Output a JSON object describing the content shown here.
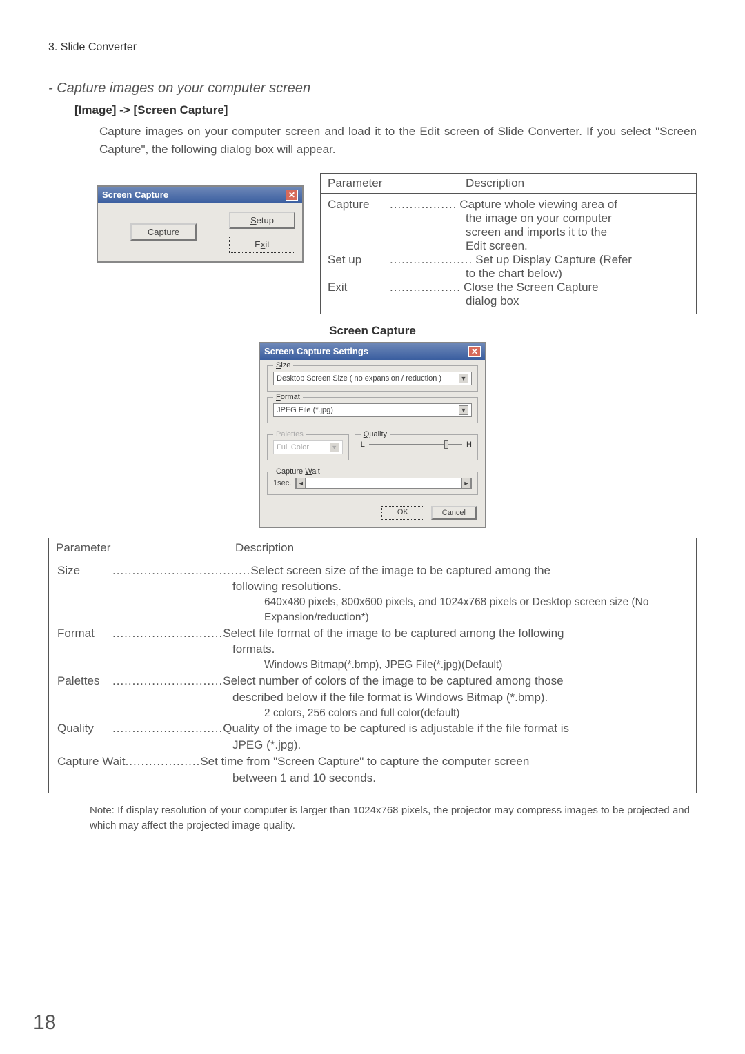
{
  "header": {
    "chapter": "3. Slide Converter"
  },
  "section_title": "- Capture images on your computer screen",
  "breadcrumb": "[Image] -> [Screen Capture]",
  "intro": "Capture images on your computer screen and load it to the Edit screen of Slide Converter.  If you select \"Screen Capture\", the following dialog box will appear.",
  "dialog1": {
    "title": "Screen Capture",
    "capture_btn": "Capture",
    "setup_btn": "Setup",
    "exit_btn": "Exit",
    "capture_u": "C",
    "setup_u": "S",
    "exit_u": "x"
  },
  "table1": {
    "h1": "Parameter",
    "h2": "Description",
    "rows": [
      {
        "name": "Capture",
        "dots": ".................",
        "desc": "Capture whole viewing area of"
      },
      {
        "cont": "the image on your computer"
      },
      {
        "cont": "screen and imports it to the"
      },
      {
        "cont": "Edit screen."
      },
      {
        "name": "Set up",
        "dots": ".....................",
        "desc": "Set up Display Capture (Refer"
      },
      {
        "cont": "to the chart below)"
      },
      {
        "name": "Exit ",
        "dots": "..................",
        "desc": "Close the Screen Capture"
      },
      {
        "cont": "dialog box"
      }
    ]
  },
  "mid_title": "Screen Capture",
  "dialog2": {
    "title": "Screen Capture Settings",
    "size_legend": "Size",
    "size_value": "Desktop Screen Size ( no expansion / reduction )",
    "format_legend": "Format",
    "format_value": "JPEG File (*.jpg)",
    "palettes_legend": "Palettes",
    "palettes_value": "Full Color",
    "quality_legend": "Quality",
    "quality_low": "L",
    "quality_high": "H",
    "wait_legend": "Capture Wait",
    "wait_value": "1sec.",
    "ok": "OK",
    "cancel": "Cancel"
  },
  "table2": {
    "h1": "Parameter",
    "h2": "Description",
    "size_label": "Size ",
    "size_dots": "...................................",
    "size_l1": "Select screen size of the image to be captured among the",
    "size_l2": "following resolutions.",
    "size_sub": "640x480 pixels, 800x600 pixels, and 1024x768 pixels or Desktop screen size (No Expansion/reduction*)",
    "format_label": "Format ",
    "format_dots": "............................",
    "format_l1": "Select file format of the image to be captured among the following",
    "format_l2": "formats.",
    "format_sub": "Windows Bitmap(*.bmp), JPEG File(*.jpg)(Default)",
    "palettes_label": "Palettes",
    "palettes_dots": "............................",
    "palettes_l1": "Select number of colors of the image to be captured among those",
    "palettes_l2": "described below if the file format is Windows Bitmap (*.bmp).",
    "palettes_sub": "2 colors, 256 colors and full color(default)",
    "quality_label": "Quality ",
    "quality_dots": "............................",
    "quality_l1": "Quality of the image to be captured is adjustable if the file format is",
    "quality_l2": "JPEG (*.jpg).",
    "capwait_label": "Capture Wait ",
    "capwait_dots": "...................",
    "capwait_l1": "Set time from \"Screen Capture\" to capture the computer screen",
    "capwait_l2": "between 1 and 10 seconds."
  },
  "note": "Note: If display resolution of your computer is larger than 1024x768 pixels, the projector may compress images to be projected and which may affect the projected image quality.",
  "page_number": "18"
}
